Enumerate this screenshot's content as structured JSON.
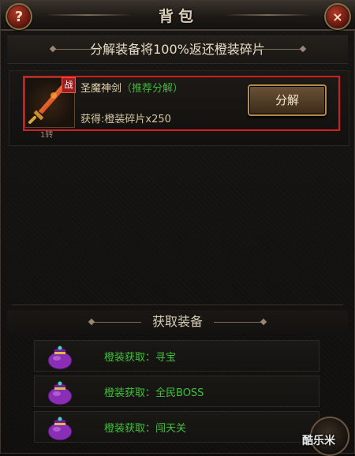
{
  "window": {
    "title": "背包",
    "help_icon_label": "?",
    "close_icon_label": "×"
  },
  "banner": {
    "text": "分解装备将100%返还橙装碎片"
  },
  "item": {
    "tag": "战",
    "name": "圣魔神剑",
    "hint": "（推荐分解）",
    "gain": "获得:橙装碎片x250",
    "level": "1转",
    "button_label": "分解"
  },
  "acquire": {
    "header": "获取装备",
    "sources": [
      {
        "label": "橙装获取：寻宝",
        "icon": "purple-bag-icon"
      },
      {
        "label": "橙装获取：全民BOSS",
        "icon": "purple-bag-icon"
      },
      {
        "label": "橙装获取：闯天关",
        "icon": "purple-bag-icon"
      }
    ]
  },
  "watermark": "酷乐米",
  "colors": {
    "highlight_border": "#d21e1e",
    "source_text": "#3fc13a",
    "hint_text": "#3fb93a"
  }
}
